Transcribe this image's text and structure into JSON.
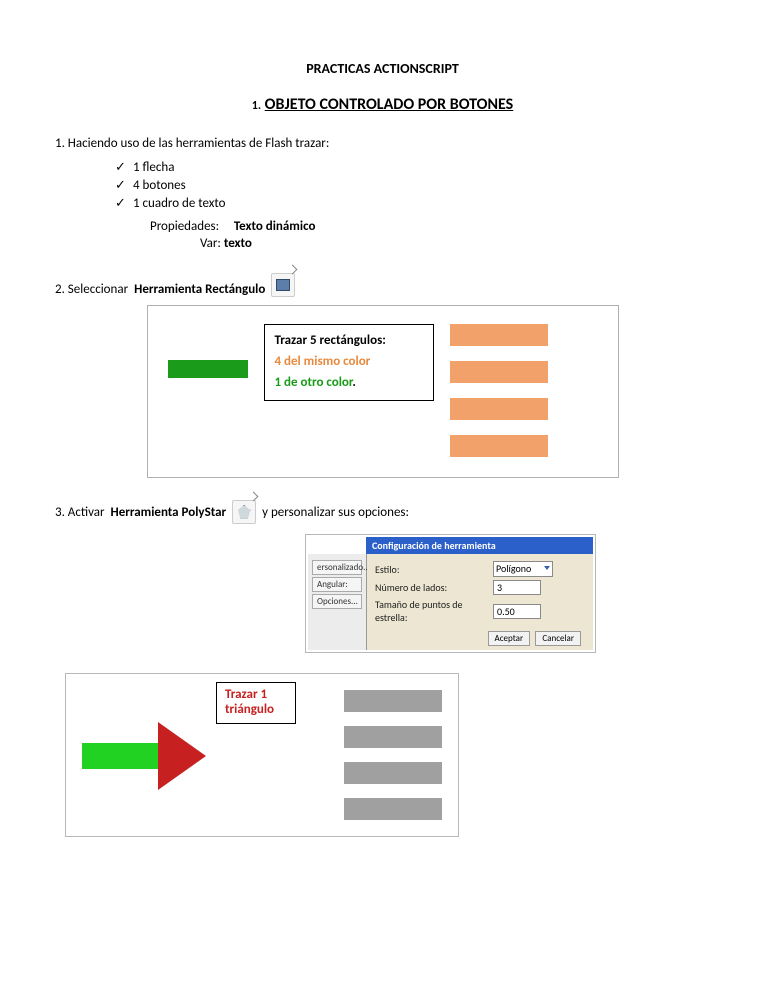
{
  "header": {
    "title": "PRACTICAS ACTIONSCRIPT",
    "section_number": "1.",
    "section_title": "OBJETO CONTROLADO POR BOTONES"
  },
  "step1": {
    "intro": "1.  Haciendo uso de las herramientas  de Flash trazar:",
    "bullets": [
      "1 flecha",
      "4 botones",
      "1 cuadro de texto"
    ],
    "prop_label": "Propiedades:",
    "prop_value": "Texto dinámico",
    "var_label": "Var:",
    "var_value": "texto"
  },
  "step2": {
    "prefix": "2. Seleccionar ",
    "tool": "Herramienta Rectángulo",
    "instr_title": "Trazar 5 rectángulos:",
    "instr_line1": "4 del mismo color",
    "instr_line2": "1 de otro color",
    "instr_dot": "."
  },
  "step3": {
    "prefix": "3. Activar ",
    "tool": "Herramienta PolyStar",
    "suffix": "  y personalizar sus opciones:",
    "dialog": {
      "title": "Configuración de herramienta",
      "left_buttons": [
        "ersonalizado...",
        "Angular:",
        "Opciones..."
      ],
      "row1_label": "Estilo:",
      "row1_value": "Polígono",
      "row2_label": "Número de lados:",
      "row2_value": "3",
      "row3_label": "Tamaño de puntos de estrella:",
      "row3_value": "0.50",
      "btn_ok": "Aceptar",
      "btn_cancel": "Cancelar"
    },
    "tri_instr_l1": "Trazar 1",
    "tri_instr_l2": "triángulo"
  }
}
